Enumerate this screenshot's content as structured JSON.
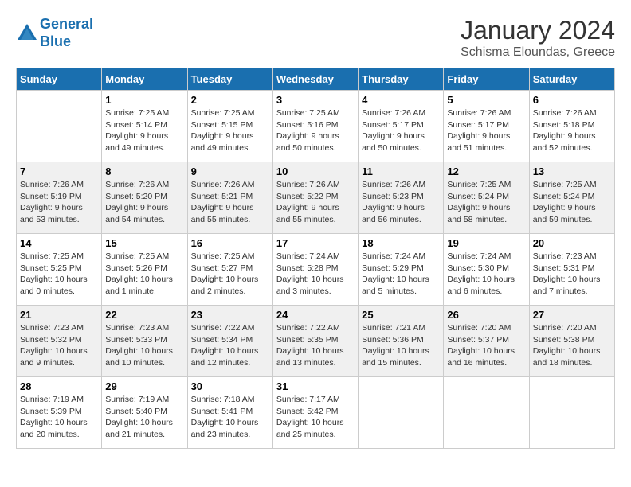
{
  "header": {
    "logo_line1": "General",
    "logo_line2": "Blue",
    "month": "January 2024",
    "location": "Schisma Eloundas, Greece"
  },
  "weekdays": [
    "Sunday",
    "Monday",
    "Tuesday",
    "Wednesday",
    "Thursday",
    "Friday",
    "Saturday"
  ],
  "weeks": [
    [
      {
        "day": "",
        "sunrise": "",
        "sunset": "",
        "daylight": ""
      },
      {
        "day": "1",
        "sunrise": "Sunrise: 7:25 AM",
        "sunset": "Sunset: 5:14 PM",
        "daylight": "Daylight: 9 hours and 49 minutes."
      },
      {
        "day": "2",
        "sunrise": "Sunrise: 7:25 AM",
        "sunset": "Sunset: 5:15 PM",
        "daylight": "Daylight: 9 hours and 49 minutes."
      },
      {
        "day": "3",
        "sunrise": "Sunrise: 7:25 AM",
        "sunset": "Sunset: 5:16 PM",
        "daylight": "Daylight: 9 hours and 50 minutes."
      },
      {
        "day": "4",
        "sunrise": "Sunrise: 7:26 AM",
        "sunset": "Sunset: 5:17 PM",
        "daylight": "Daylight: 9 hours and 50 minutes."
      },
      {
        "day": "5",
        "sunrise": "Sunrise: 7:26 AM",
        "sunset": "Sunset: 5:17 PM",
        "daylight": "Daylight: 9 hours and 51 minutes."
      },
      {
        "day": "6",
        "sunrise": "Sunrise: 7:26 AM",
        "sunset": "Sunset: 5:18 PM",
        "daylight": "Daylight: 9 hours and 52 minutes."
      }
    ],
    [
      {
        "day": "7",
        "sunrise": "Sunrise: 7:26 AM",
        "sunset": "Sunset: 5:19 PM",
        "daylight": "Daylight: 9 hours and 53 minutes."
      },
      {
        "day": "8",
        "sunrise": "Sunrise: 7:26 AM",
        "sunset": "Sunset: 5:20 PM",
        "daylight": "Daylight: 9 hours and 54 minutes."
      },
      {
        "day": "9",
        "sunrise": "Sunrise: 7:26 AM",
        "sunset": "Sunset: 5:21 PM",
        "daylight": "Daylight: 9 hours and 55 minutes."
      },
      {
        "day": "10",
        "sunrise": "Sunrise: 7:26 AM",
        "sunset": "Sunset: 5:22 PM",
        "daylight": "Daylight: 9 hours and 55 minutes."
      },
      {
        "day": "11",
        "sunrise": "Sunrise: 7:26 AM",
        "sunset": "Sunset: 5:23 PM",
        "daylight": "Daylight: 9 hours and 56 minutes."
      },
      {
        "day": "12",
        "sunrise": "Sunrise: 7:25 AM",
        "sunset": "Sunset: 5:24 PM",
        "daylight": "Daylight: 9 hours and 58 minutes."
      },
      {
        "day": "13",
        "sunrise": "Sunrise: 7:25 AM",
        "sunset": "Sunset: 5:24 PM",
        "daylight": "Daylight: 9 hours and 59 minutes."
      }
    ],
    [
      {
        "day": "14",
        "sunrise": "Sunrise: 7:25 AM",
        "sunset": "Sunset: 5:25 PM",
        "daylight": "Daylight: 10 hours and 0 minutes."
      },
      {
        "day": "15",
        "sunrise": "Sunrise: 7:25 AM",
        "sunset": "Sunset: 5:26 PM",
        "daylight": "Daylight: 10 hours and 1 minute."
      },
      {
        "day": "16",
        "sunrise": "Sunrise: 7:25 AM",
        "sunset": "Sunset: 5:27 PM",
        "daylight": "Daylight: 10 hours and 2 minutes."
      },
      {
        "day": "17",
        "sunrise": "Sunrise: 7:24 AM",
        "sunset": "Sunset: 5:28 PM",
        "daylight": "Daylight: 10 hours and 3 minutes."
      },
      {
        "day": "18",
        "sunrise": "Sunrise: 7:24 AM",
        "sunset": "Sunset: 5:29 PM",
        "daylight": "Daylight: 10 hours and 5 minutes."
      },
      {
        "day": "19",
        "sunrise": "Sunrise: 7:24 AM",
        "sunset": "Sunset: 5:30 PM",
        "daylight": "Daylight: 10 hours and 6 minutes."
      },
      {
        "day": "20",
        "sunrise": "Sunrise: 7:23 AM",
        "sunset": "Sunset: 5:31 PM",
        "daylight": "Daylight: 10 hours and 7 minutes."
      }
    ],
    [
      {
        "day": "21",
        "sunrise": "Sunrise: 7:23 AM",
        "sunset": "Sunset: 5:32 PM",
        "daylight": "Daylight: 10 hours and 9 minutes."
      },
      {
        "day": "22",
        "sunrise": "Sunrise: 7:23 AM",
        "sunset": "Sunset: 5:33 PM",
        "daylight": "Daylight: 10 hours and 10 minutes."
      },
      {
        "day": "23",
        "sunrise": "Sunrise: 7:22 AM",
        "sunset": "Sunset: 5:34 PM",
        "daylight": "Daylight: 10 hours and 12 minutes."
      },
      {
        "day": "24",
        "sunrise": "Sunrise: 7:22 AM",
        "sunset": "Sunset: 5:35 PM",
        "daylight": "Daylight: 10 hours and 13 minutes."
      },
      {
        "day": "25",
        "sunrise": "Sunrise: 7:21 AM",
        "sunset": "Sunset: 5:36 PM",
        "daylight": "Daylight: 10 hours and 15 minutes."
      },
      {
        "day": "26",
        "sunrise": "Sunrise: 7:20 AM",
        "sunset": "Sunset: 5:37 PM",
        "daylight": "Daylight: 10 hours and 16 minutes."
      },
      {
        "day": "27",
        "sunrise": "Sunrise: 7:20 AM",
        "sunset": "Sunset: 5:38 PM",
        "daylight": "Daylight: 10 hours and 18 minutes."
      }
    ],
    [
      {
        "day": "28",
        "sunrise": "Sunrise: 7:19 AM",
        "sunset": "Sunset: 5:39 PM",
        "daylight": "Daylight: 10 hours and 20 minutes."
      },
      {
        "day": "29",
        "sunrise": "Sunrise: 7:19 AM",
        "sunset": "Sunset: 5:40 PM",
        "daylight": "Daylight: 10 hours and 21 minutes."
      },
      {
        "day": "30",
        "sunrise": "Sunrise: 7:18 AM",
        "sunset": "Sunset: 5:41 PM",
        "daylight": "Daylight: 10 hours and 23 minutes."
      },
      {
        "day": "31",
        "sunrise": "Sunrise: 7:17 AM",
        "sunset": "Sunset: 5:42 PM",
        "daylight": "Daylight: 10 hours and 25 minutes."
      },
      {
        "day": "",
        "sunrise": "",
        "sunset": "",
        "daylight": ""
      },
      {
        "day": "",
        "sunrise": "",
        "sunset": "",
        "daylight": ""
      },
      {
        "day": "",
        "sunrise": "",
        "sunset": "",
        "daylight": ""
      }
    ]
  ]
}
